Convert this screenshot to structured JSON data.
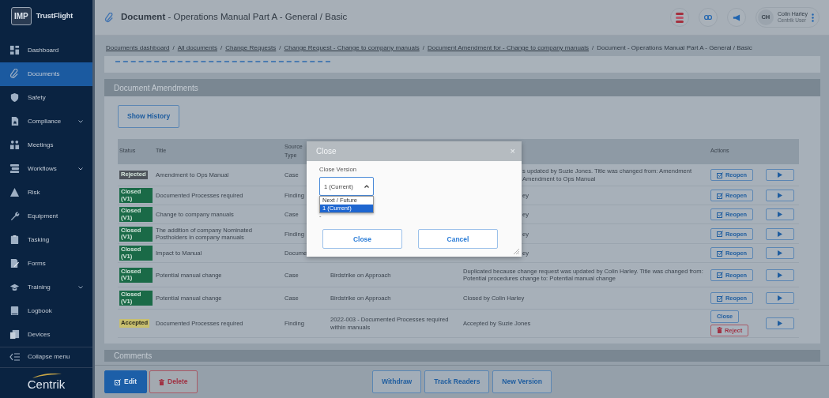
{
  "app": {
    "logo_badge": "IMP",
    "name": "TrustFlight"
  },
  "sidebar": {
    "items": [
      {
        "label": "Dashboard",
        "selected": false,
        "expandable": false
      },
      {
        "label": "Documents",
        "selected": true,
        "expandable": false
      },
      {
        "label": "Safety",
        "selected": false,
        "expandable": false
      },
      {
        "label": "Compliance",
        "selected": false,
        "expandable": true
      },
      {
        "label": "Meetings",
        "selected": false,
        "expandable": false
      },
      {
        "label": "Workflows",
        "selected": false,
        "expandable": true
      },
      {
        "label": "Risk",
        "selected": false,
        "expandable": false
      },
      {
        "label": "Equipment",
        "selected": false,
        "expandable": false
      },
      {
        "label": "Tasking",
        "selected": false,
        "expandable": false
      },
      {
        "label": "Forms",
        "selected": false,
        "expandable": false
      },
      {
        "label": "Training",
        "selected": false,
        "expandable": true
      },
      {
        "label": "Logbook",
        "selected": false,
        "expandable": false
      },
      {
        "label": "Devices",
        "selected": false,
        "expandable": false
      }
    ],
    "collapse": "Collapse menu",
    "brand": "Centrik"
  },
  "header": {
    "title": "**Document** - Operations Manual Part A - General / Basic",
    "user": {
      "initials": "CH",
      "name": "Colin Harley",
      "role": "Centrik User"
    }
  },
  "breadcrumbs": [
    {
      "label": "Documents dashboard",
      "kind": "link"
    },
    {
      "label": "/",
      "kind": "separator"
    },
    {
      "label": "All documents",
      "kind": "link"
    },
    {
      "label": "/",
      "kind": "separator"
    },
    {
      "label": "Change Requests",
      "kind": "link"
    },
    {
      "label": "/",
      "kind": "separator"
    },
    {
      "label": "Change Request - Change to company manuals",
      "kind": "link"
    },
    {
      "label": "/",
      "kind": "separator"
    },
    {
      "label": "Document Amendment for - Change to company manuals",
      "kind": "link"
    },
    {
      "label": "/",
      "kind": "separator"
    },
    {
      "label": "Document - Operations Manual Part A - General / Basic",
      "kind": "current"
    }
  ],
  "amendments": {
    "title": "Document Amendments",
    "history_button": "Show History",
    "columns": {
      "status": "Status",
      "title": "Title",
      "type": "Source Type",
      "actions": "Actions"
    },
    "rows": [
      {
        "status": {
          "label": "Rejected",
          "color": "#4d535a"
        },
        "title": "Amendment to Ops Manual",
        "type": "Case",
        "comment": "s updated by Suzie Jones. Title was changed from: Amendment Amendment to Ops Manual",
        "covered": true,
        "actions": [
          {
            "label": "Reopen",
            "kind": "reopen"
          }
        ]
      },
      {
        "status": {
          "label": "Closed (V1)",
          "color": "#1a6a47"
        },
        "title": "Documented Processes required",
        "type": "Finding",
        "comment": "ey",
        "covered": true,
        "actions": [
          {
            "label": "Reopen",
            "kind": "reopen"
          }
        ]
      },
      {
        "status": {
          "label": "Closed (V1)",
          "color": "#1a6a47"
        },
        "title": "Change to company manuals",
        "type": "Case",
        "comment": "ey",
        "covered": true,
        "actions": [
          {
            "label": "Reopen",
            "kind": "reopen"
          }
        ]
      },
      {
        "status": {
          "label": "Closed (V1)",
          "color": "#1a6a47"
        },
        "title": "The addition of company Nominated Postholders in company manuals",
        "type": "Finding",
        "comment": "ey",
        "covered": true,
        "actions": [
          {
            "label": "Reopen",
            "kind": "reopen"
          }
        ]
      },
      {
        "status": {
          "label": "Closed (V1)",
          "color": "#1a6a47"
        },
        "title": "Impact to Manual",
        "type": "Docume",
        "comment": "ey",
        "covered": true,
        "actions": [
          {
            "label": "Reopen",
            "kind": "reopen"
          }
        ]
      },
      {
        "status": {
          "label": "Closed (V1)",
          "color": "#1a6a47"
        },
        "title": "Potential manual change",
        "type": "Case",
        "source": "Birdstrike on Approach",
        "comment": "Duplicated because change request was updated by Colin Harley. Title was changed from: Potential procedures change to: Potential manual change",
        "covered": false,
        "actions": [
          {
            "label": "Reopen",
            "kind": "reopen"
          }
        ]
      },
      {
        "status": {
          "label": "Closed (V1)",
          "color": "#1a6a47"
        },
        "title": "Potential manual change",
        "type": "Case",
        "source": "Birdstrike on Approach",
        "comment": "Closed by Colin Harley",
        "covered": false,
        "actions": [
          {
            "label": "Reopen",
            "kind": "reopen"
          }
        ]
      },
      {
        "status": {
          "label": "Accepted",
          "color": "#c8bf6e"
        },
        "title": "Documented Processes required",
        "type": "Finding",
        "source": "2022-003 - Documented Processes required within manuals",
        "comment": "Accepted by Suzie Jones",
        "covered": false,
        "actions": [
          {
            "label": "Close",
            "kind": "close"
          },
          {
            "label": "Reject",
            "kind": "reject"
          }
        ]
      }
    ]
  },
  "comments": {
    "title": "Comments"
  },
  "footer_buttons": [
    {
      "label": "Edit",
      "kind": "primary"
    },
    {
      "label": "Delete",
      "kind": "danger"
    },
    {
      "label": "Withdraw",
      "kind": "secondary"
    },
    {
      "label": "Track Readers",
      "kind": "secondary"
    },
    {
      "label": "New Version",
      "kind": "secondary"
    }
  ],
  "modal": {
    "title": "Close",
    "close": "×",
    "field_label": "Close Version",
    "value": "1 (Current)",
    "expanded": true,
    "options": [
      {
        "label": "Next / Future",
        "selected": false
      },
      {
        "label": "1 (Current)",
        "selected": true
      }
    ],
    "hint": "-",
    "buttons": [
      "Close",
      "Cancel"
    ]
  }
}
